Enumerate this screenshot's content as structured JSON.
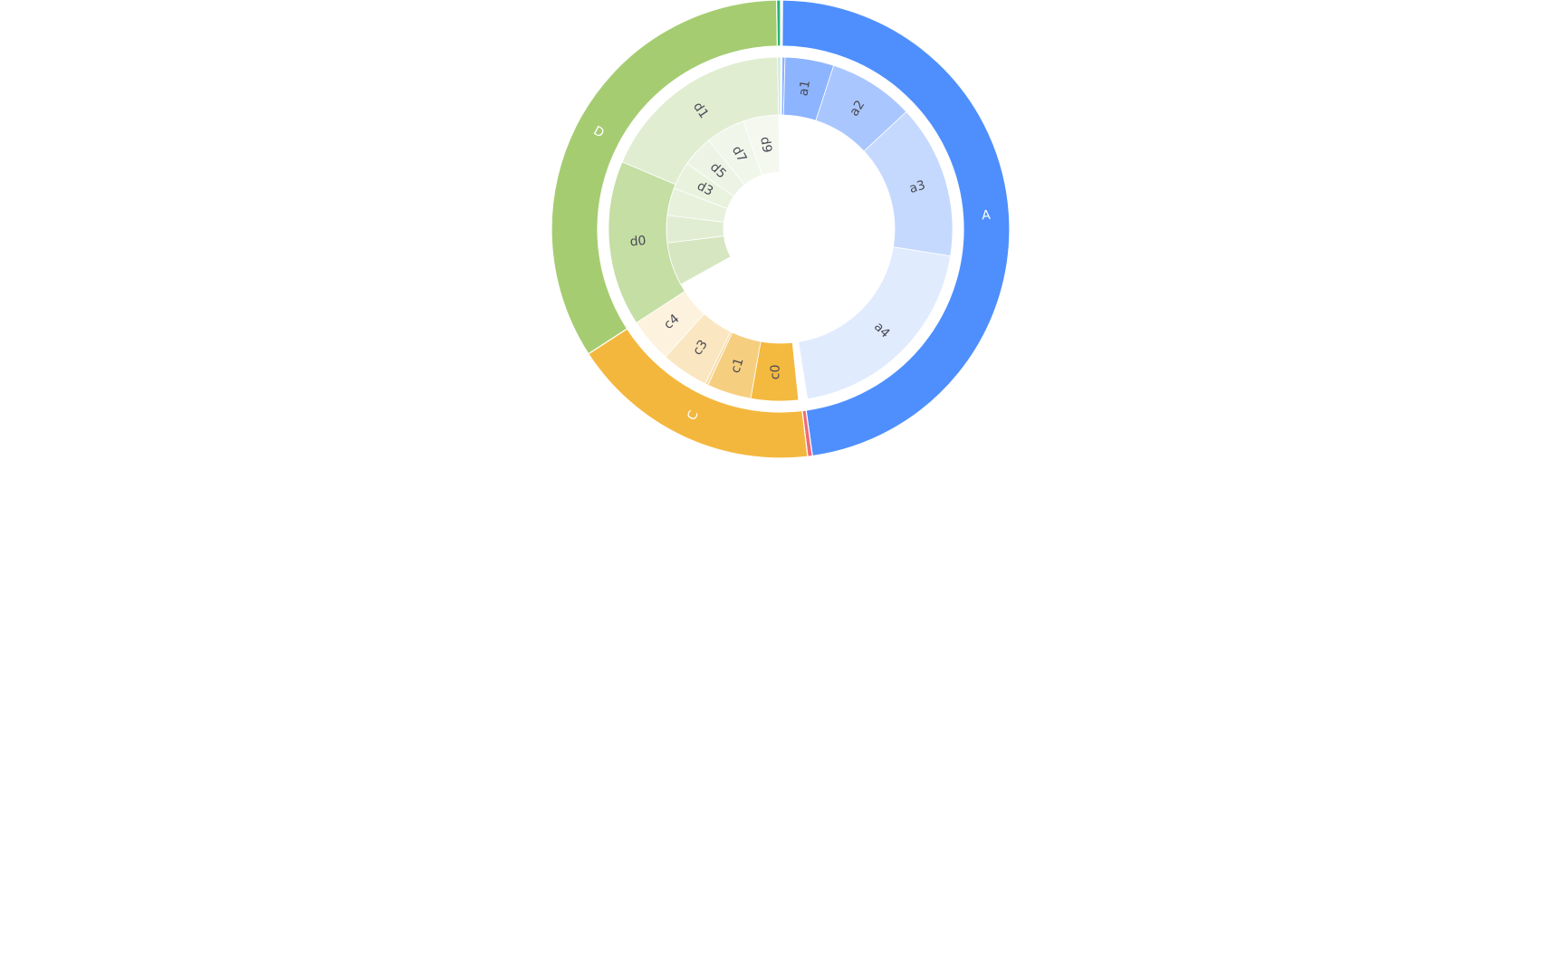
{
  "chart_data": {
    "type": "sunburst",
    "title": "",
    "rings": [
      {
        "level": "outer",
        "segments": [
          {
            "name": "A",
            "label": "A",
            "start_deg": 0.5,
            "end_deg": 172.0,
            "color": "#4e8ffd",
            "text_color": "#ffffff"
          },
          {
            "name": "B",
            "label": "",
            "start_deg": 172.0,
            "end_deg": 173.2,
            "color": "#ec6c7a",
            "text_color": "#ffffff"
          },
          {
            "name": "C",
            "label": "C",
            "start_deg": 173.2,
            "end_deg": 237.0,
            "color": "#f4b73d",
            "text_color": "#ffffff"
          },
          {
            "name": "D",
            "label": "D",
            "start_deg": 237.0,
            "end_deg": 359.0,
            "color": "#a6cc72",
            "text_color": "#ffffff"
          },
          {
            "name": "E",
            "label": "",
            "start_deg": 359.0,
            "end_deg": 360.0,
            "color": "#2bb573",
            "text_color": "#ffffff"
          }
        ]
      },
      {
        "level": "inner",
        "segments": [
          {
            "name": "a0",
            "label": "",
            "start_deg": 0.5,
            "end_deg": 1.5,
            "color": "#8db4fe"
          },
          {
            "name": "a1",
            "label": "a1",
            "start_deg": 1.5,
            "end_deg": 18.0,
            "color": "#8db4fe"
          },
          {
            "name": "a2",
            "label": "a2",
            "start_deg": 18.0,
            "end_deg": 47.0,
            "color": "#a9c7fe"
          },
          {
            "name": "a3",
            "label": "a3",
            "start_deg": 47.0,
            "end_deg": 99.0,
            "color": "#c5d9fe"
          },
          {
            "name": "a4",
            "label": "a4",
            "start_deg": 99.0,
            "end_deg": 171.0,
            "color": "#e1ebfe"
          },
          {
            "name": "c0",
            "label": "c0",
            "start_deg": 174.0,
            "end_deg": 190.0,
            "color": "#f4b93f"
          },
          {
            "name": "c1",
            "label": "c1",
            "start_deg": 190.0,
            "end_deg": 205.0,
            "color": "#f6ce7f"
          },
          {
            "name": "c2",
            "label": "",
            "start_deg": 205.0,
            "end_deg": 206.0,
            "color": "#f8dca7"
          },
          {
            "name": "c3",
            "label": "c3",
            "start_deg": 206.0,
            "end_deg": 222.0,
            "color": "#fae6c0"
          },
          {
            "name": "c4",
            "label": "c4",
            "start_deg": 222.0,
            "end_deg": 237.0,
            "color": "#fdf2dd"
          },
          {
            "name": "d0",
            "label": "d0",
            "start_deg": 237.0,
            "end_deg": 293.0,
            "color": "#c4dea3"
          },
          {
            "name": "d1",
            "label": "d1",
            "start_deg": 293.0,
            "end_deg": 359.0,
            "color": "#e0edd1"
          },
          {
            "name": "e0",
            "label": "",
            "start_deg": 359.0,
            "end_deg": 360.0,
            "color": "#cfe9da"
          }
        ]
      },
      {
        "level": "innermost",
        "segments": [
          {
            "name": "d-1",
            "label": "",
            "start_deg": 241.0,
            "end_deg": 263.0,
            "color": "#d5e6c1"
          },
          {
            "name": "d-2",
            "label": "",
            "start_deg": 263.0,
            "end_deg": 277.0,
            "color": "#e1edd3"
          },
          {
            "name": "d-3",
            "label": "",
            "start_deg": 277.0,
            "end_deg": 291.0,
            "color": "#e7f1dc"
          },
          {
            "name": "d3",
            "label": "d3",
            "start_deg": 291.0,
            "end_deg": 305.0,
            "color": "#e9f2dd"
          },
          {
            "name": "d5",
            "label": "d5",
            "start_deg": 305.0,
            "end_deg": 321.0,
            "color": "#edf4e5"
          },
          {
            "name": "d7",
            "label": "d7",
            "start_deg": 321.0,
            "end_deg": 341.0,
            "color": "#f0f6ea"
          },
          {
            "name": "d9",
            "label": "d9",
            "start_deg": 341.0,
            "end_deg": 359.0,
            "color": "#f4f8ef"
          }
        ]
      }
    ]
  }
}
